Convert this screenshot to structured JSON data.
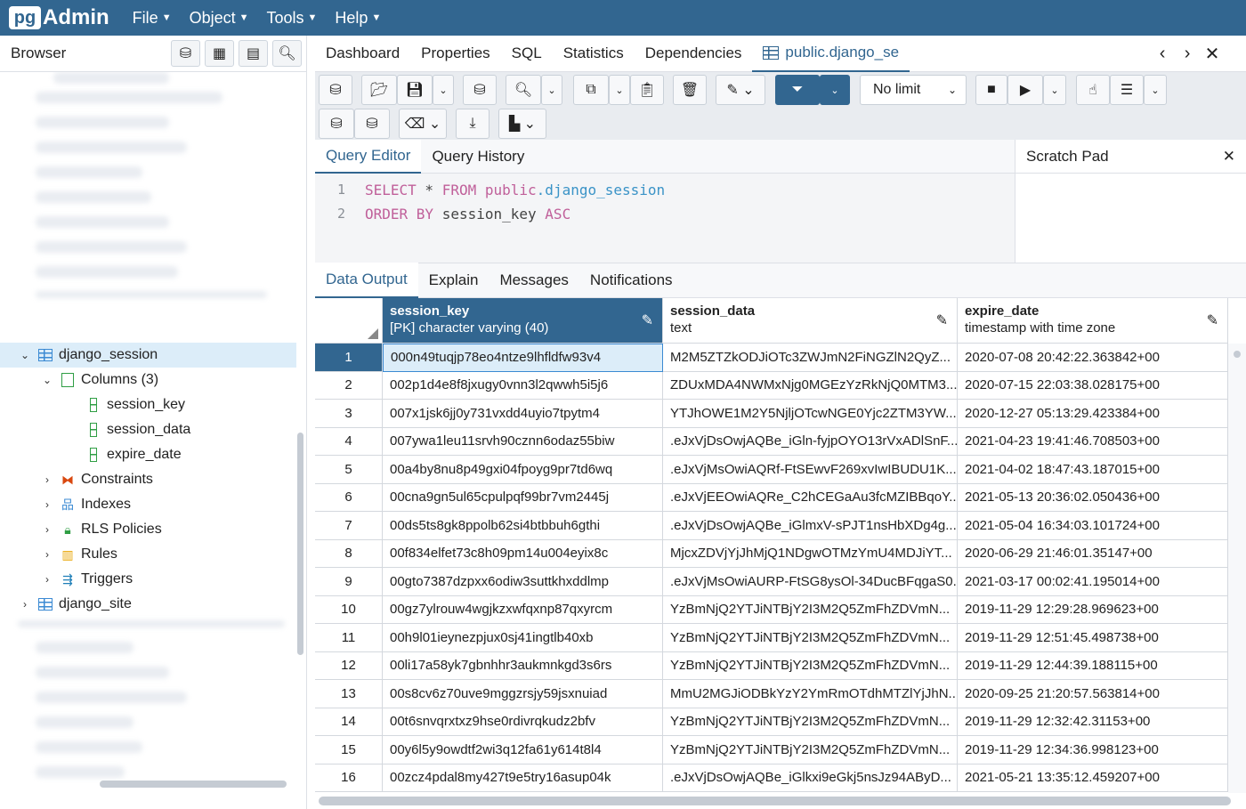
{
  "app": {
    "logo_pg": "pg",
    "logo_admin": "Admin"
  },
  "menu": [
    {
      "label": "File"
    },
    {
      "label": "Object"
    },
    {
      "label": "Tools"
    },
    {
      "label": "Help"
    }
  ],
  "browser": {
    "title": "Browser",
    "tree": {
      "django_session": "django_session",
      "columns": "Columns (3)",
      "col_session_key": "session_key",
      "col_session_data": "session_data",
      "col_expire_date": "expire_date",
      "constraints": "Constraints",
      "indexes": "Indexes",
      "rls": "RLS Policies",
      "rules": "Rules",
      "triggers": "Triggers",
      "django_site": "django_site"
    }
  },
  "tabs": {
    "dashboard": "Dashboard",
    "properties": "Properties",
    "sql": "SQL",
    "statistics": "Statistics",
    "dependencies": "Dependencies",
    "query_tab": "public.django_se"
  },
  "toolbar": {
    "limit": "No limit"
  },
  "editor": {
    "tab_query": "Query Editor",
    "tab_history": "Query History",
    "scratch_title": "Scratch Pad",
    "lines": [
      "1",
      "2"
    ],
    "kw_select": "SELECT",
    "star": " * ",
    "kw_from": "FROM",
    "schema": " public",
    "dot_table": ".django_session",
    "kw_order": "ORDER BY",
    "order_col": " session_key ",
    "kw_asc": "ASC"
  },
  "output_tabs": {
    "data_output": "Data Output",
    "explain": "Explain",
    "messages": "Messages",
    "notifications": "Notifications"
  },
  "grid": {
    "columns": [
      {
        "name": "session_key",
        "type": "[PK] character varying (40)"
      },
      {
        "name": "session_data",
        "type": "text"
      },
      {
        "name": "expire_date",
        "type": "timestamp with time zone"
      }
    ],
    "rows": [
      {
        "n": "1",
        "key": "000n49tuqjp78eo4ntze9lhfldfw93v4",
        "data": "M2M5ZTZkODJiOTc3ZWJmN2FiNGZlN2QyZ...",
        "date": "2020-07-08 20:42:22.363842+00"
      },
      {
        "n": "2",
        "key": "002p1d4e8f8jxugy0vnn3l2qwwh5i5j6",
        "data": "ZDUxMDA4NWMxNjg0MGEzYzRkNjQ0MTM3...",
        "date": "2020-07-15 22:03:38.028175+00"
      },
      {
        "n": "3",
        "key": "007x1jsk6jj0y731vxdd4uyio7tpytm4",
        "data": "YTJhOWE1M2Y5NjljOTcwNGE0Yjc2ZTM3YW...",
        "date": "2020-12-27 05:13:29.423384+00"
      },
      {
        "n": "4",
        "key": "007ywa1leu11srvh90cznn6odaz55biw",
        "data": ".eJxVjDsOwjAQBe_iGln-fyjpOYO13rVxADlSnF...",
        "date": "2021-04-23 19:41:46.708503+00"
      },
      {
        "n": "5",
        "key": "00a4by8nu8p49gxi04fpoyg9pr7td6wq",
        "data": ".eJxVjMsOwiAQRf-FtSEwvF269xvIwIBUDU1K...",
        "date": "2021-04-02 18:47:43.187015+00"
      },
      {
        "n": "6",
        "key": "00cna9gn5ul65cpulpqf99br7vm2445j",
        "data": ".eJxVjEEOwiAQRe_C2hCEGaAu3fcMZIBBqoY...",
        "date": "2021-05-13 20:36:02.050436+00"
      },
      {
        "n": "7",
        "key": "00ds5ts8gk8ppolb62si4btbbuh6gthi",
        "data": ".eJxVjDsOwjAQBe_iGlmxV-sPJT1nsHbXDg4g...",
        "date": "2021-05-04 16:34:03.101724+00"
      },
      {
        "n": "8",
        "key": "00f834elfet73c8h09pm14u004eyix8c",
        "data": "MjcxZDVjYjJhMjQ1NDgwOTMzYmU4MDJiYT...",
        "date": "2020-06-29 21:46:01.35147+00"
      },
      {
        "n": "9",
        "key": "00gto7387dzpxx6odiw3suttkhxddlmp",
        "data": ".eJxVjMsOwiAURP-FtSG8ysOl-34DucBFqgaS0...",
        "date": "2021-03-17 00:02:41.195014+00"
      },
      {
        "n": "10",
        "key": "00gz7ylrouw4wgjkzxwfqxnp87qxyrcm",
        "data": "YzBmNjQ2YTJiNTBjY2I3M2Q5ZmFhZDVmN...",
        "date": "2019-11-29 12:29:28.969623+00"
      },
      {
        "n": "11",
        "key": "00h9l01ieynezpjux0sj41ingtlb40xb",
        "data": "YzBmNjQ2YTJiNTBjY2I3M2Q5ZmFhZDVmN...",
        "date": "2019-11-29 12:51:45.498738+00"
      },
      {
        "n": "12",
        "key": "00li17a58yk7gbnhhr3aukmnkgd3s6rs",
        "data": "YzBmNjQ2YTJiNTBjY2I3M2Q5ZmFhZDVmN...",
        "date": "2019-11-29 12:44:39.188115+00"
      },
      {
        "n": "13",
        "key": "00s8cv6z70uve9mggzrsjy59jsxnuiad",
        "data": "MmU2MGJiODBkYzY2YmRmOTdhMTZlYjJhN...",
        "date": "2020-09-25 21:20:57.563814+00"
      },
      {
        "n": "14",
        "key": "00t6snvqrxtxz9hse0rdivrqkudz2bfv",
        "data": "YzBmNjQ2YTJiNTBjY2I3M2Q5ZmFhZDVmN...",
        "date": "2019-11-29 12:32:42.31153+00"
      },
      {
        "n": "15",
        "key": "00y6l5y9owdtf2wi3q12fa61y614t8l4",
        "data": "YzBmNjQ2YTJiNTBjY2I3M2Q5ZmFhZDVmN...",
        "date": "2019-11-29 12:34:36.998123+00"
      },
      {
        "n": "16",
        "key": "00zcz4pdal8my427t9e5try16asup04k",
        "data": ".eJxVjDsOwjAQBe_iGlkxi9eGkj5nsJz94AByD...",
        "date": "2021-05-21 13:35:12.459207+00"
      }
    ]
  },
  "colors": {
    "header_bg": "#326690",
    "selection_bg": "#dcedf9",
    "keyword": "#c0609a",
    "identifier": "#3a93c7"
  }
}
